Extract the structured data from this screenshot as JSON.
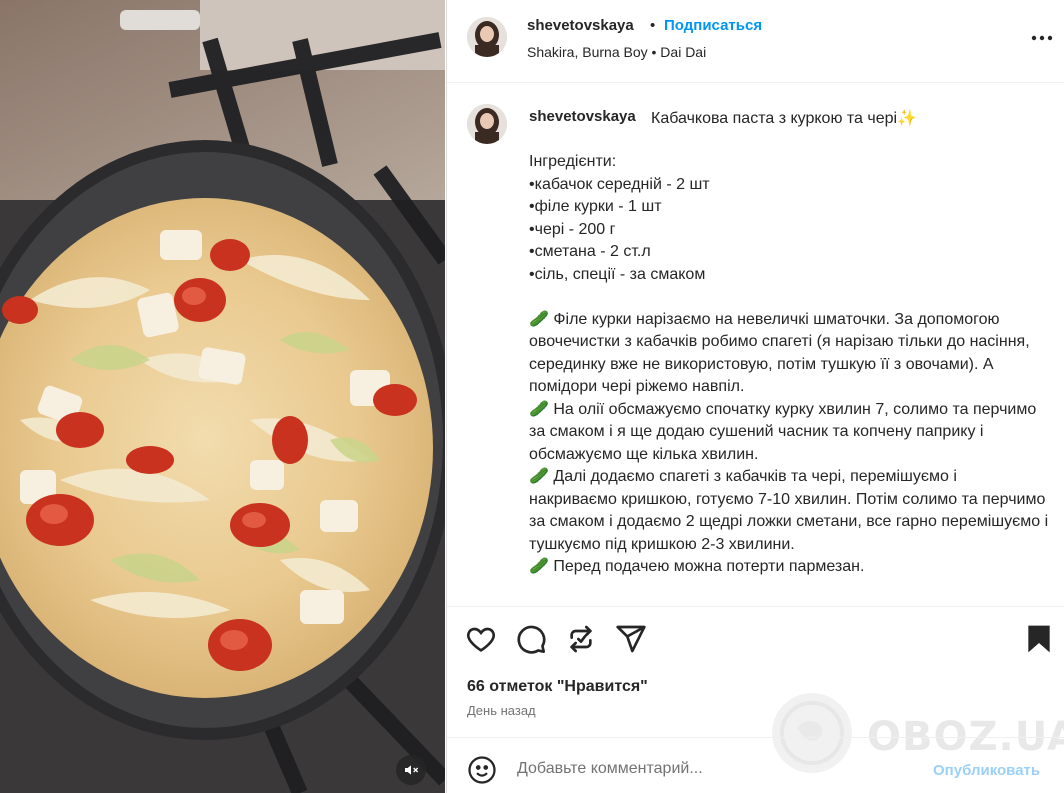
{
  "post": {
    "username": "shevetovskaya",
    "separator": "•",
    "follow_label": "Подписаться",
    "music": "Shakira, Burna Boy • Dai Dai",
    "caption_title": "Кабачкова паста з куркою та чері✨",
    "caption_body": "Інгредієнти:\n•кабачок середній - 2 шт\n•філе курки - 1 шт\n•чері - 200 г\n•сметана - 2 ст.л\n•сіль, спеції - за смаком\n\n🥒 Філе курки нарізаємо на невеличкі шматочки. За допомогою овочечистки з кабачків робимо спагеті (я нарізаю тільки до насіння, серединку вже не використовую, потім тушкую її з овочами). А помідори чері ріжемо навпіл.\n🥒 На олії обсмажуємо спочатку курку хвилин 7, солимо та перчимо за смаком і я ще додаю сушений часник та копчену паприку і обсмажуємо ще кілька хвилин.\n🥒 Далі додаємо спагеті з кабачків та чері, перемішуємо і накриваємо кришкою, готуємо 7-10 хвилин. Потім солимо та перчимо за смаком і додаємо 2 щедрі ложки сметани, все гарно перемішуємо і тушкуємо під кришкою 2-3 хвилини.\n🥒 Перед подачею можна потерти пармезан.",
    "likes": "66 отметок \"Нравится\"",
    "date": "День назад"
  },
  "comment": {
    "placeholder": "Добавьте комментарий...",
    "publish_label": "Опубликовать"
  },
  "watermark": {
    "text": "OBOZ.UA"
  },
  "icons": {
    "more": "more-horizontal-icon",
    "like": "heart-icon",
    "comment": "comment-icon",
    "repost": "repost-icon",
    "share": "share-icon",
    "save": "bookmark-icon",
    "emoji": "emoji-icon",
    "mute": "speaker-muted-icon"
  },
  "colors": {
    "link_blue": "#0095f6",
    "publish_disabled": "#9bd0f8",
    "text_primary": "#262626",
    "text_secondary": "#737373"
  }
}
